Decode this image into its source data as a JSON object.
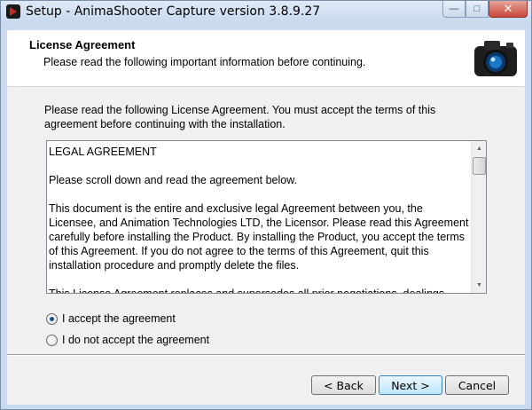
{
  "window": {
    "title": "Setup - AnimaShooter Capture version 3.8.9.27",
    "buttons": {
      "minimize": "—",
      "maximize": "□",
      "close": "✕"
    }
  },
  "header": {
    "title": "License Agreement",
    "subtitle": "Please read the following important information before continuing."
  },
  "intro": "Please read the following License Agreement. You must accept the terms of this agreement before continuing with the installation.",
  "license": {
    "paragraphs": [
      "LEGAL AGREEMENT",
      "Please scroll down and read the agreement below.",
      "This document is the entire and exclusive legal Agreement between you, the Licensee, and Animation Technologies LTD, the Licensor. Please read this Agreement carefully before installing the Product. By installing the Product, you accept the terms of this Agreement. If you do not agree to the terms of this Agreement, quit this installation procedure and promptly delete the files.",
      "This License Agreement replaces and supersedes all prior negotiations, dealings,"
    ]
  },
  "options": {
    "accept": {
      "label": "I accept the agreement",
      "checked": true
    },
    "decline": {
      "label": "I do not accept the agreement",
      "checked": false
    }
  },
  "buttons": {
    "back": "< Back",
    "next": "Next >",
    "cancel": "Cancel"
  },
  "icons": {
    "app": "animashooter-app-icon",
    "header": "camera-icon"
  }
}
